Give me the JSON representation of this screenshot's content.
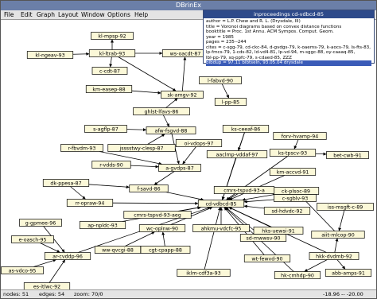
{
  "window": {
    "title": "DBrinEx"
  },
  "menu": [
    "File",
    "Edit",
    "Graph",
    "Layout",
    "Window",
    "Options",
    "Help"
  ],
  "status": {
    "nodes": "nodes: 51",
    "edges": "edges: 54",
    "zoom": "zoom: 70/0",
    "coords": "-18.96 -- -20.00"
  },
  "info": {
    "title": "inproceedings cd-vdbcd-85",
    "lines": [
      "author = L.P. Chew and R. L. (Drysdale, III)",
      "title = Voronoi diagrams based on convex distance functions",
      "booktitle = Proc. 1st Annu. ACM Sympos. Comput. Geom.",
      "year = 1985",
      "pages = 235--244",
      "cites = c-sgg-79, cd-ckc-84, d-gvdgs-79, k-oaems-79, k-aocs-79, ls-fts-83,",
      "lp-fmcs-79, 1-cds-82, ld-vd4-81, lp-vd-94, m-sggc-88, oy-caaaq-85,",
      "lbl-pp-79, sq-ppfc-79, s-cdaed-85, ZZZ",
      "bibdup = 97.11 bibtseln, 93.05.04 drysdale"
    ]
  },
  "graph": {
    "nodes": [
      {
        "id": "kl-mpsp-92",
        "label": "kl-mpsp-92"
      },
      {
        "id": "kl-ngeav-93",
        "label": "kl-ngeav-93"
      },
      {
        "id": "kl-ltrab-93",
        "label": "kl-ltrab-93"
      },
      {
        "id": "ws-oacdt-87",
        "label": "ws-oacdt-87"
      },
      {
        "id": "c-cdt-87",
        "label": "c-cdt-87"
      },
      {
        "id": "km-easep-88",
        "label": "km-easep-88"
      },
      {
        "id": "sk-amgv-92",
        "label": "sk-amgv-92"
      },
      {
        "id": "l-fabvd-90",
        "label": "l-fabvd-90"
      },
      {
        "id": "l-pp-85",
        "label": "l-pp-85"
      },
      {
        "id": "ghlst-lfavs-86",
        "label": "ghlst-lfavs-86"
      },
      {
        "id": "s-agflp-87",
        "label": "s-agflp-87"
      },
      {
        "id": "afw-fsgvd-88",
        "label": "afw-fsgvd-88"
      },
      {
        "id": "ks-ceeaf-86",
        "label": "ks-ceeaf-86"
      },
      {
        "id": "oi-vdops-97",
        "label": "oi-vdops-97"
      },
      {
        "id": "r-fbvdm-93",
        "label": "r-fbvdm-93"
      },
      {
        "id": "jsssstwy-clesp-87",
        "label": "jsssstwy-clesp-87"
      },
      {
        "id": "aaclmp-vddaf-97",
        "label": "aaclmp-vddaf-97"
      },
      {
        "id": "forv-hvamp-94",
        "label": "forv-hvamp-94"
      },
      {
        "id": "ks-tpscv-93",
        "label": "ks-tpscv-93"
      },
      {
        "id": "bet-cwb-91",
        "label": "bet-cwb-91"
      },
      {
        "id": "r-vdds-90",
        "label": "r-vdds-90"
      },
      {
        "id": "a-gvdps-87",
        "label": "a-gvdps-87"
      },
      {
        "id": "km-accvd-91",
        "label": "km-accvd-91"
      },
      {
        "id": "dk-ppesa-87",
        "label": "dk-ppesa-87"
      },
      {
        "id": "ck-plsoc-89",
        "label": "ck-plsoc-89"
      },
      {
        "id": "f-savd-86",
        "label": "f-savd-86"
      },
      {
        "id": "cmrs-tspvd-93-a",
        "label": "cmrs-tspvd-93-a"
      },
      {
        "id": "c-sgblv-93",
        "label": "c-sgblv-93"
      },
      {
        "id": "rr-opraw-94",
        "label": "rr-opraw-94"
      },
      {
        "id": "cd-vdbcd-85",
        "label": "cd-vdbcd-85"
      },
      {
        "id": "sd-hdvdc-92",
        "label": "sd-hdvdc-92"
      },
      {
        "id": "iss-msgft-c-89",
        "label": "iss-msgft-c-89"
      },
      {
        "id": "g-gpmee-96",
        "label": "g-gpmee-96"
      },
      {
        "id": "cmrs-tspvd-93-aeg",
        "label": "cmrs-tspvd-93-aeg"
      },
      {
        "id": "aiit-mlcop-90",
        "label": "aiit-mlcop-90"
      },
      {
        "id": "e-oasch-95",
        "label": "e-oasch-95"
      },
      {
        "id": "ap-npldc-93",
        "label": "ap-npldc-93"
      },
      {
        "id": "wc-oplnw-90",
        "label": "wc-oplnw-90"
      },
      {
        "id": "ahkmu-vdcfc-95",
        "label": "ahkmu-vdcfc-95"
      },
      {
        "id": "hks-uewsi-91",
        "label": "hks-uewsi-91"
      },
      {
        "id": "ar-cvddp-96",
        "label": "ar-cvddp-96"
      },
      {
        "id": "sd-mwwsv-90",
        "label": "sd-mwwsv-90"
      },
      {
        "id": "hkk-dvdmb-92",
        "label": "hkk-dvdmb-92"
      },
      {
        "id": "as-vdco-95",
        "label": "as-vdco-95"
      },
      {
        "id": "ww-qvcgi-88",
        "label": "ww-qvcgi-88"
      },
      {
        "id": "cgt-cpapp-88",
        "label": "cgt-cpapp-88"
      },
      {
        "id": "wt-fewvd-90",
        "label": "wt-fewvd-90"
      },
      {
        "id": "abb-amps-91",
        "label": "abb-amps-91"
      },
      {
        "id": "hk-cmhdp-90",
        "label": "hk-cmhdp-90"
      },
      {
        "id": "es-itlwc-92",
        "label": "es-itlwc-92"
      },
      {
        "id": "iklm-cdf3a-93",
        "label": "iklm-cdf3a-93"
      }
    ],
    "edges": [
      [
        "kl-ngeav-93",
        "kl-ltrab-93"
      ],
      [
        "kl-ltrab-93",
        "kl-mpsp-92"
      ],
      [
        "kl-ltrab-93",
        "ws-oacdt-87"
      ],
      [
        "kl-ltrab-93",
        "c-cdt-87"
      ],
      [
        "kl-ltrab-93",
        "sk-amgv-92"
      ],
      [
        "sk-amgv-92",
        "ws-oacdt-87"
      ],
      [
        "km-easep-88",
        "sk-amgv-92"
      ],
      [
        "ghlst-lfavs-86",
        "sk-amgv-92"
      ],
      [
        "l-fabvd-90",
        "l-pp-85"
      ],
      [
        "ghlst-lfavs-86",
        "afw-fsgvd-88"
      ],
      [
        "s-agflp-87",
        "afw-fsgvd-88"
      ],
      [
        "jsssstwy-clesp-87",
        "afw-fsgvd-88"
      ],
      [
        "r-fbvdm-93",
        "a-gvdps-87"
      ],
      [
        "r-vdds-90",
        "a-gvdps-87"
      ],
      [
        "afw-fsgvd-88",
        "a-gvdps-87"
      ],
      [
        "oi-vdops-97",
        "a-gvdps-87"
      ],
      [
        "a-gvdps-87",
        "f-savd-86"
      ],
      [
        "dk-ppesa-87",
        "f-savd-86"
      ],
      [
        "f-savd-86",
        "cd-vdbcd-85"
      ],
      [
        "aaclmp-vddaf-97",
        "cd-vdbcd-85"
      ],
      [
        "ks-ceeaf-86",
        "cd-vdbcd-85"
      ],
      [
        "forv-hvamp-94",
        "ks-tpscv-93"
      ],
      [
        "ks-tpscv-93",
        "bet-cwb-91"
      ],
      [
        "ks-tpscv-93",
        "cd-vdbcd-85"
      ],
      [
        "km-accvd-91",
        "cd-vdbcd-85"
      ],
      [
        "ck-plsoc-89",
        "cd-vdbcd-85"
      ],
      [
        "cmrs-tspvd-93-a",
        "cd-vdbcd-85"
      ],
      [
        "c-sgblv-93",
        "cd-vdbcd-85"
      ],
      [
        "sd-hdvdc-92",
        "cd-vdbcd-85"
      ],
      [
        "cmrs-tspvd-93-aeg",
        "cd-vdbcd-85"
      ],
      [
        "rr-opraw-94",
        "cd-vdbcd-85"
      ],
      [
        "ap-npldc-93",
        "cd-vdbcd-85"
      ],
      [
        "wc-oplnw-90",
        "cd-vdbcd-85"
      ],
      [
        "ahkmu-vdcfc-95",
        "cd-vdbcd-85"
      ],
      [
        "hks-uewsi-91",
        "cd-vdbcd-85"
      ],
      [
        "sd-mwwsv-90",
        "cd-vdbcd-85"
      ],
      [
        "wt-fewvd-90",
        "cd-vdbcd-85"
      ],
      [
        "hk-cmhdp-90",
        "cd-vdbcd-85"
      ],
      [
        "iklm-cdf3a-93",
        "cd-vdbcd-85"
      ],
      [
        "ar-cvddp-96",
        "cd-vdbcd-85"
      ],
      [
        "g-gpmee-96",
        "ar-cvddp-96"
      ],
      [
        "e-oasch-95",
        "ar-cvddp-96"
      ],
      [
        "as-vdco-95",
        "ar-cvddp-96"
      ],
      [
        "es-itlwc-92",
        "ar-cvddp-96"
      ],
      [
        "ww-qvcgi-88",
        "wc-oplnw-90"
      ],
      [
        "cgt-cpapp-88",
        "wc-oplnw-90"
      ],
      [
        "aiit-mlcop-90",
        "ck-plsoc-89"
      ],
      [
        "iss-msgft-c-89",
        "aiit-mlcop-90"
      ],
      [
        "hkk-dvdmb-92",
        "aiit-mlcop-90"
      ],
      [
        "hkk-dvdmb-92",
        "abb-amps-91"
      ],
      [
        "hkk-dvdmb-92",
        "hk-cmhdp-90"
      ],
      [
        "hkk-dvdmb-92",
        "cd-vdbcd-85"
      ],
      [
        "dk-ppesa-87",
        "rr-opraw-94"
      ],
      [
        "ks-ceeaf-86",
        "aaclmp-vddaf-97"
      ]
    ]
  }
}
